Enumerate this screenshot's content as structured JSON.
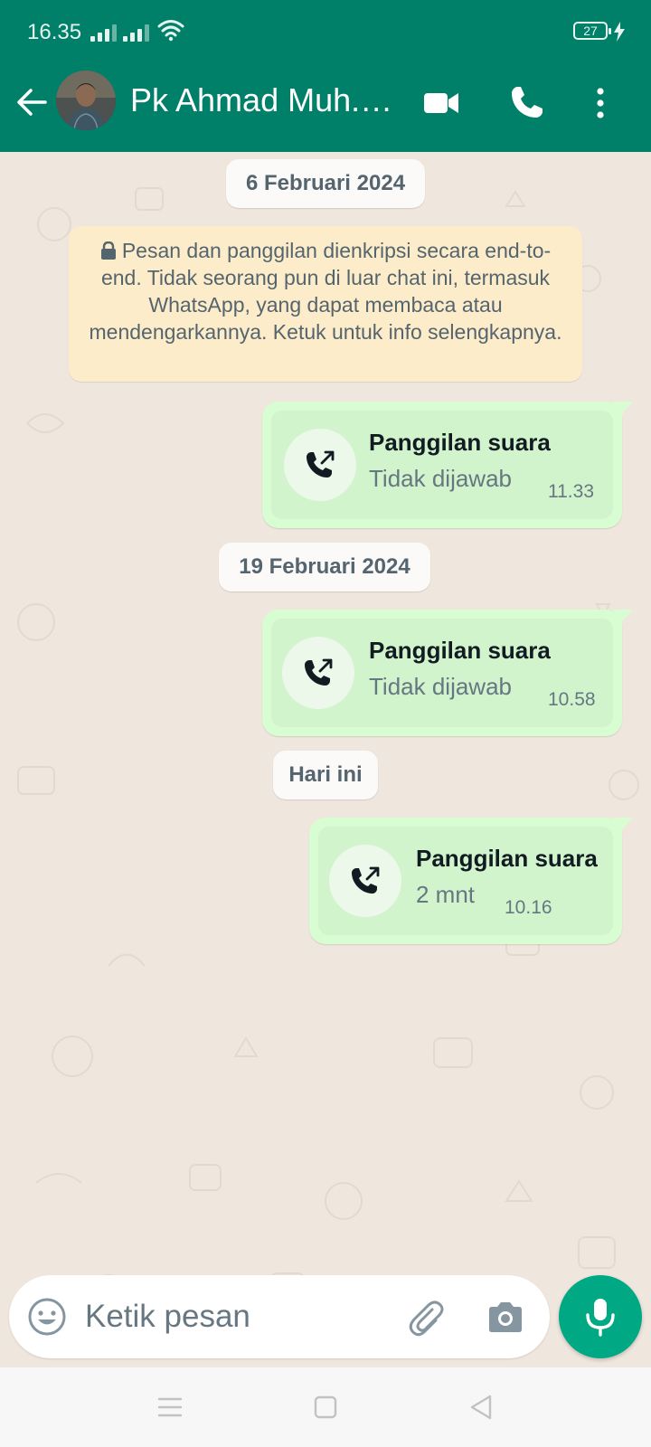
{
  "status_bar": {
    "time": "16.35",
    "battery": "27"
  },
  "header": {
    "contact_name": "Pk Ahmad Muh.Y..."
  },
  "chat": {
    "encryption_notice": "Pesan dan panggilan dienkripsi secara end-to-end. Tidak seorang pun di luar chat ini, termasuk WhatsApp, yang dapat membaca atau mendengarkannya. Ketuk untuk info selengkapnya.",
    "groups": [
      {
        "date": "6 Februari 2024",
        "call": {
          "title": "Panggilan suara",
          "status": "Tidak dijawab",
          "time": "11.33"
        }
      },
      {
        "date": "19 Februari 2024",
        "call": {
          "title": "Panggilan suara",
          "status": "Tidak dijawab",
          "time": "10.58"
        }
      },
      {
        "date": "Hari ini",
        "call": {
          "title": "Panggilan suara",
          "status": "2 mnt",
          "time": "10.16"
        }
      }
    ]
  },
  "input": {
    "placeholder": "Ketik pesan"
  },
  "icons": {
    "back": "arrow-left-icon",
    "video": "video-call-icon",
    "voice": "phone-icon",
    "menu": "more-vert-icon",
    "emoji": "emoji-icon",
    "attach": "paperclip-icon",
    "camera": "camera-icon",
    "mic": "mic-icon",
    "call": "outgoing-call-icon",
    "lock": "lock-icon"
  },
  "colors": {
    "brand": "#008069",
    "accent": "#00a884",
    "bubble": "#d9fdd3",
    "notice": "#fdecc9",
    "background": "#efe7dd"
  }
}
